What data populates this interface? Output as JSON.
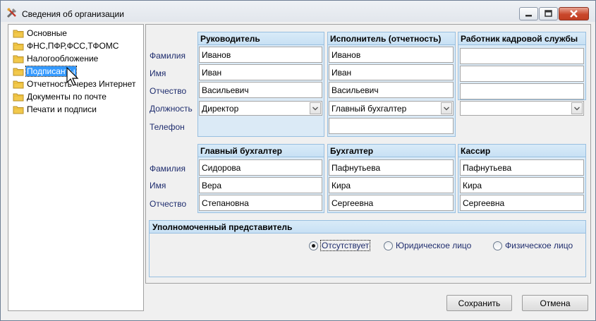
{
  "window": {
    "title": "Сведения об организации"
  },
  "sidebar": {
    "items": [
      {
        "label": "Основные",
        "selected": false
      },
      {
        "label": "ФНС,ПФР,ФСС,ТФОМС",
        "selected": false
      },
      {
        "label": "Налогообложение",
        "selected": false
      },
      {
        "label": "Подписанты",
        "selected": true
      },
      {
        "label": "Отчетность через Интернет",
        "selected": false
      },
      {
        "label": "Документы по почте",
        "selected": false
      },
      {
        "label": "Печати и подписи",
        "selected": false
      }
    ]
  },
  "row_labels": {
    "surname": "Фамилия",
    "name": "Имя",
    "patronymic": "Отчество",
    "position": "Должность",
    "phone": "Телефон"
  },
  "top_groups": [
    {
      "title": "Руководитель",
      "surname": "Иванов",
      "name": "Иван",
      "patronymic": "Васильевич",
      "position": "Директор",
      "phone": ""
    },
    {
      "title": "Исполнитель (отчетность)",
      "surname": "Иванов",
      "name": "Иван",
      "patronymic": "Васильевич",
      "position": "Главный бухгалтер",
      "phone": ""
    },
    {
      "title": "Работник кадровой службы",
      "surname": "",
      "name": "",
      "patronymic": "",
      "position": ""
    }
  ],
  "bottom_groups": [
    {
      "title": "Главный бухгалтер",
      "surname": "Сидорова",
      "name": "Вера",
      "patronymic": "Степановна"
    },
    {
      "title": "Бухгалтер",
      "surname": "Пафнутьева",
      "name": "Кира",
      "patronymic": "Сергеевна"
    },
    {
      "title": "Кассир",
      "surname": "Пафнутьева",
      "name": "Кира",
      "patronymic": "Сергеевна"
    }
  ],
  "representative": {
    "title": "Уполномоченный представитель",
    "options": [
      {
        "label": "Отсутствует",
        "checked": true
      },
      {
        "label": "Юридическое лицо",
        "checked": false
      },
      {
        "label": "Физическое лицо",
        "checked": false
      }
    ]
  },
  "buttons": {
    "save": "Сохранить",
    "cancel": "Отмена"
  },
  "colors": {
    "group_header": "#c8e0f4",
    "group_body": "#dbeaf6",
    "label_text": "#1f2d6e",
    "selection": "#3399ff"
  }
}
